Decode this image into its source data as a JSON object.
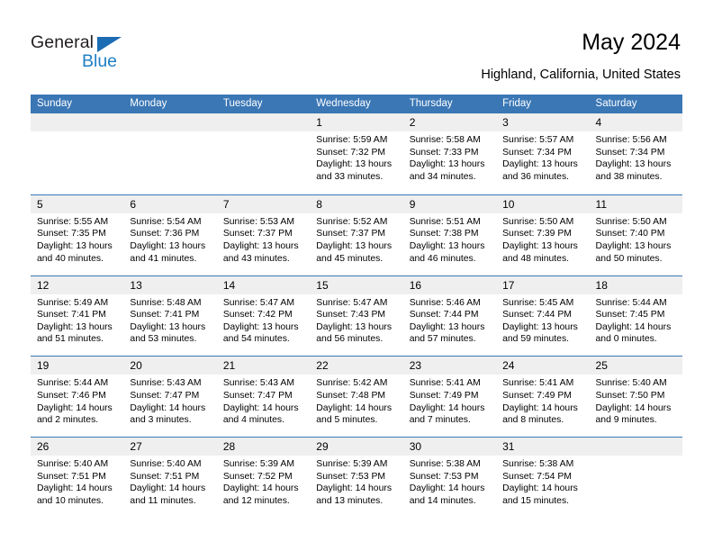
{
  "brand": {
    "name_top": "General",
    "name_bottom": "Blue",
    "triangle_color": "#1b6cb3",
    "blue_color": "#1f7fc4"
  },
  "header": {
    "title": "May 2024",
    "subtitle": "Highland, California, United States"
  },
  "theme": {
    "header_bar": "#3b77b5",
    "day_band": "#efefef",
    "text": "#000000",
    "cell_bg": "#ffffff"
  },
  "weekdays": [
    "Sunday",
    "Monday",
    "Tuesday",
    "Wednesday",
    "Thursday",
    "Friday",
    "Saturday"
  ],
  "weeks": [
    [
      {
        "day": "",
        "empty": true
      },
      {
        "day": "",
        "empty": true
      },
      {
        "day": "",
        "empty": true
      },
      {
        "day": "1",
        "sunrise": "Sunrise: 5:59 AM",
        "sunset": "Sunset: 7:32 PM",
        "daylight": "Daylight: 13 hours and 33 minutes."
      },
      {
        "day": "2",
        "sunrise": "Sunrise: 5:58 AM",
        "sunset": "Sunset: 7:33 PM",
        "daylight": "Daylight: 13 hours and 34 minutes."
      },
      {
        "day": "3",
        "sunrise": "Sunrise: 5:57 AM",
        "sunset": "Sunset: 7:34 PM",
        "daylight": "Daylight: 13 hours and 36 minutes."
      },
      {
        "day": "4",
        "sunrise": "Sunrise: 5:56 AM",
        "sunset": "Sunset: 7:34 PM",
        "daylight": "Daylight: 13 hours and 38 minutes."
      }
    ],
    [
      {
        "day": "5",
        "sunrise": "Sunrise: 5:55 AM",
        "sunset": "Sunset: 7:35 PM",
        "daylight": "Daylight: 13 hours and 40 minutes."
      },
      {
        "day": "6",
        "sunrise": "Sunrise: 5:54 AM",
        "sunset": "Sunset: 7:36 PM",
        "daylight": "Daylight: 13 hours and 41 minutes."
      },
      {
        "day": "7",
        "sunrise": "Sunrise: 5:53 AM",
        "sunset": "Sunset: 7:37 PM",
        "daylight": "Daylight: 13 hours and 43 minutes."
      },
      {
        "day": "8",
        "sunrise": "Sunrise: 5:52 AM",
        "sunset": "Sunset: 7:37 PM",
        "daylight": "Daylight: 13 hours and 45 minutes."
      },
      {
        "day": "9",
        "sunrise": "Sunrise: 5:51 AM",
        "sunset": "Sunset: 7:38 PM",
        "daylight": "Daylight: 13 hours and 46 minutes."
      },
      {
        "day": "10",
        "sunrise": "Sunrise: 5:50 AM",
        "sunset": "Sunset: 7:39 PM",
        "daylight": "Daylight: 13 hours and 48 minutes."
      },
      {
        "day": "11",
        "sunrise": "Sunrise: 5:50 AM",
        "sunset": "Sunset: 7:40 PM",
        "daylight": "Daylight: 13 hours and 50 minutes."
      }
    ],
    [
      {
        "day": "12",
        "sunrise": "Sunrise: 5:49 AM",
        "sunset": "Sunset: 7:41 PM",
        "daylight": "Daylight: 13 hours and 51 minutes."
      },
      {
        "day": "13",
        "sunrise": "Sunrise: 5:48 AM",
        "sunset": "Sunset: 7:41 PM",
        "daylight": "Daylight: 13 hours and 53 minutes."
      },
      {
        "day": "14",
        "sunrise": "Sunrise: 5:47 AM",
        "sunset": "Sunset: 7:42 PM",
        "daylight": "Daylight: 13 hours and 54 minutes."
      },
      {
        "day": "15",
        "sunrise": "Sunrise: 5:47 AM",
        "sunset": "Sunset: 7:43 PM",
        "daylight": "Daylight: 13 hours and 56 minutes."
      },
      {
        "day": "16",
        "sunrise": "Sunrise: 5:46 AM",
        "sunset": "Sunset: 7:44 PM",
        "daylight": "Daylight: 13 hours and 57 minutes."
      },
      {
        "day": "17",
        "sunrise": "Sunrise: 5:45 AM",
        "sunset": "Sunset: 7:44 PM",
        "daylight": "Daylight: 13 hours and 59 minutes."
      },
      {
        "day": "18",
        "sunrise": "Sunrise: 5:44 AM",
        "sunset": "Sunset: 7:45 PM",
        "daylight": "Daylight: 14 hours and 0 minutes."
      }
    ],
    [
      {
        "day": "19",
        "sunrise": "Sunrise: 5:44 AM",
        "sunset": "Sunset: 7:46 PM",
        "daylight": "Daylight: 14 hours and 2 minutes."
      },
      {
        "day": "20",
        "sunrise": "Sunrise: 5:43 AM",
        "sunset": "Sunset: 7:47 PM",
        "daylight": "Daylight: 14 hours and 3 minutes."
      },
      {
        "day": "21",
        "sunrise": "Sunrise: 5:43 AM",
        "sunset": "Sunset: 7:47 PM",
        "daylight": "Daylight: 14 hours and 4 minutes."
      },
      {
        "day": "22",
        "sunrise": "Sunrise: 5:42 AM",
        "sunset": "Sunset: 7:48 PM",
        "daylight": "Daylight: 14 hours and 5 minutes."
      },
      {
        "day": "23",
        "sunrise": "Sunrise: 5:41 AM",
        "sunset": "Sunset: 7:49 PM",
        "daylight": "Daylight: 14 hours and 7 minutes."
      },
      {
        "day": "24",
        "sunrise": "Sunrise: 5:41 AM",
        "sunset": "Sunset: 7:49 PM",
        "daylight": "Daylight: 14 hours and 8 minutes."
      },
      {
        "day": "25",
        "sunrise": "Sunrise: 5:40 AM",
        "sunset": "Sunset: 7:50 PM",
        "daylight": "Daylight: 14 hours and 9 minutes."
      }
    ],
    [
      {
        "day": "26",
        "sunrise": "Sunrise: 5:40 AM",
        "sunset": "Sunset: 7:51 PM",
        "daylight": "Daylight: 14 hours and 10 minutes."
      },
      {
        "day": "27",
        "sunrise": "Sunrise: 5:40 AM",
        "sunset": "Sunset: 7:51 PM",
        "daylight": "Daylight: 14 hours and 11 minutes."
      },
      {
        "day": "28",
        "sunrise": "Sunrise: 5:39 AM",
        "sunset": "Sunset: 7:52 PM",
        "daylight": "Daylight: 14 hours and 12 minutes."
      },
      {
        "day": "29",
        "sunrise": "Sunrise: 5:39 AM",
        "sunset": "Sunset: 7:53 PM",
        "daylight": "Daylight: 14 hours and 13 minutes."
      },
      {
        "day": "30",
        "sunrise": "Sunrise: 5:38 AM",
        "sunset": "Sunset: 7:53 PM",
        "daylight": "Daylight: 14 hours and 14 minutes."
      },
      {
        "day": "31",
        "sunrise": "Sunrise: 5:38 AM",
        "sunset": "Sunset: 7:54 PM",
        "daylight": "Daylight: 14 hours and 15 minutes."
      },
      {
        "day": "",
        "empty": true
      }
    ]
  ]
}
